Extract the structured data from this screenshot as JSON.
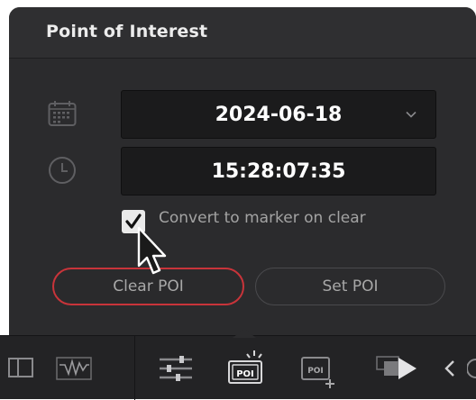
{
  "popup": {
    "title": "Point of Interest",
    "date_value": "2024-06-18",
    "time_value": "15:28:07:35",
    "checkbox": {
      "label": "Convert to marker on clear",
      "checked": true
    },
    "clear_button_label": "Clear POI",
    "set_button_label": "Set POI"
  },
  "toolbar": {
    "items": [
      {
        "icon": "clip-view-icon"
      },
      {
        "icon": "waveform-icon"
      },
      {
        "icon": "sliders-icon"
      },
      {
        "icon": "poi-icon",
        "text": "POI",
        "active": true
      },
      {
        "icon": "poi-add-icon",
        "text": "POI"
      },
      {
        "icon": "clip-play-icon"
      },
      {
        "icon": "chevron-left-icon"
      }
    ]
  },
  "colors": {
    "popup_bg": "#2b2b2d",
    "field_bg": "#1b1b1c",
    "accent_red": "#c8343a",
    "toolbar_bg": "#232325"
  }
}
